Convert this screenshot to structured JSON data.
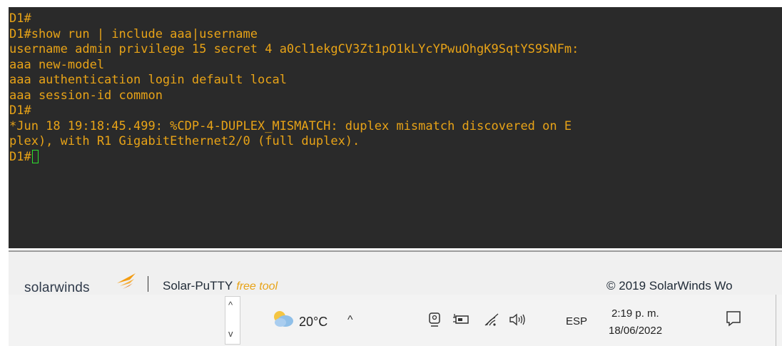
{
  "terminal": {
    "lines": [
      "D1#",
      "D1#show run | include aaa|username",
      "username admin privilege 15 secret 4 a0cl1ekgCV3Zt1pO1kLYcYPwuOhgK9SqtYS9SNFm:",
      "aaa new-model",
      "aaa authentication login default local",
      "aaa session-id common",
      "D1#",
      "*Jun 18 19:18:45.499: %CDP-4-DUPLEX_MISMATCH: duplex mismatch discovered on E",
      "plex), with R1 GigabitEthernet2/0 (full duplex).",
      "D1#"
    ],
    "text_color": "#e8a317",
    "background": "#2a2a2a",
    "cursor_color": "#2ee02e"
  },
  "statusbar": {
    "logo_text": "solarwinds",
    "product_name": "Solar-PuTTY",
    "product_tag": "free tool",
    "copyright": "© 2019 SolarWinds Wo"
  },
  "taskbar": {
    "overflow_up": "^",
    "overflow_down": "v",
    "temperature": "20°C",
    "tray_chevron": "^",
    "language": "ESP",
    "time": "2:19 p. m.",
    "date": "18/06/2022",
    "icons": [
      "weather-icon",
      "meet-now-icon",
      "battery-icon",
      "wifi-icon",
      "speaker-icon",
      "notification-icon"
    ]
  }
}
